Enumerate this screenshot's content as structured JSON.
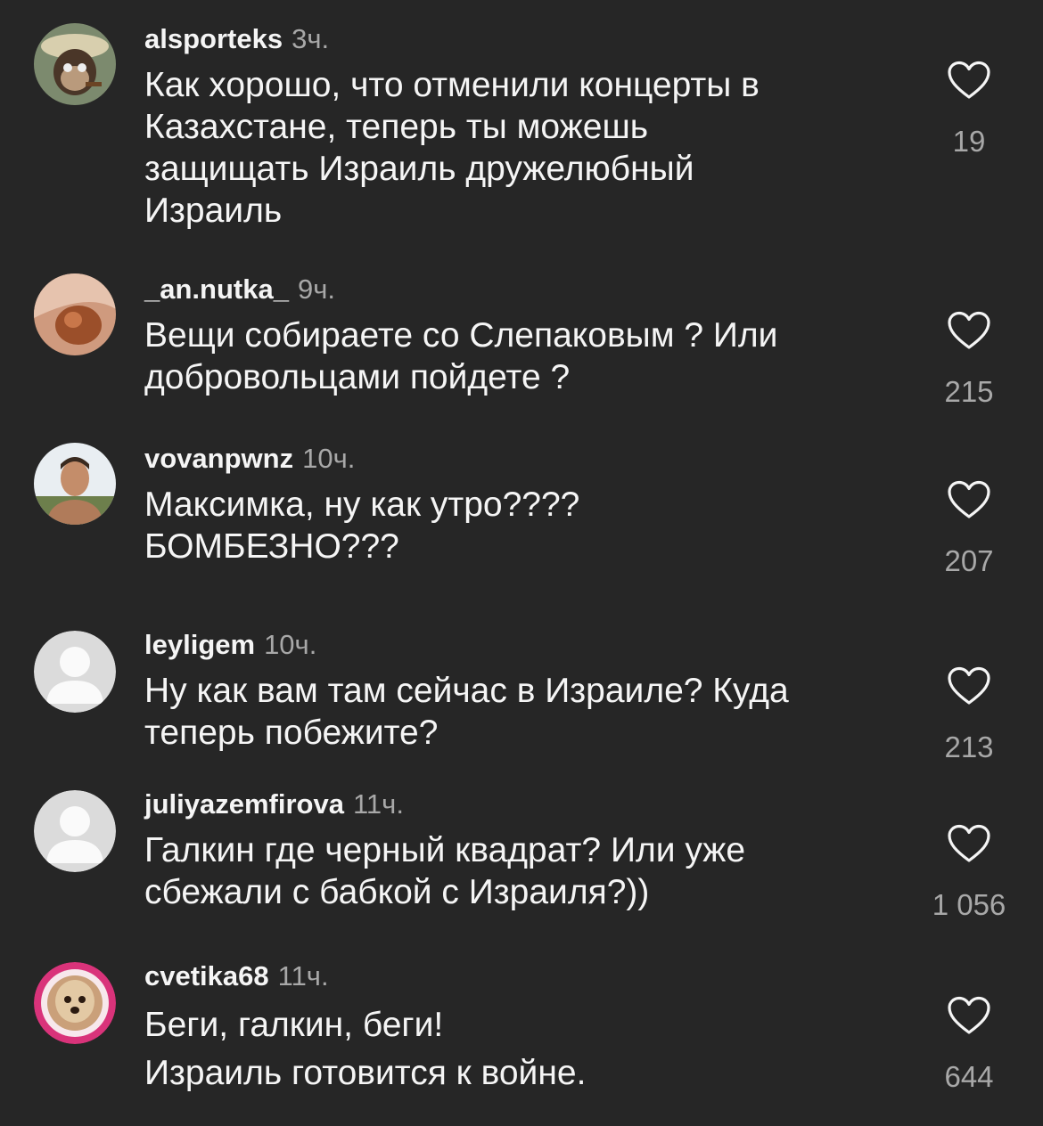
{
  "comments": [
    {
      "username": "alsporteks",
      "time": "3ч.",
      "text": "Как хорошо, что отменили концерты в\nКазахстане, теперь ты можешь\nзащищать Израиль дружелюбный\nИзраиль",
      "likes": "19",
      "avatar": "monkey-photo"
    },
    {
      "username": "_an.nutka_",
      "time": "9ч.",
      "text": "Вещи собираете со Слепаковым ? Или\nдобровольцами пойдете ?",
      "likes": "215",
      "avatar": "photo"
    },
    {
      "username": "vovanpwnz",
      "time": "10ч.",
      "text": "Максимка, ну как утро????\nБОМБЕЗНО???",
      "likes": "207",
      "avatar": "photo"
    },
    {
      "username": "leyligem",
      "time": "10ч.",
      "text": "Ну как вам там сейчас в Израиле? Куда\nтеперь побежите?",
      "likes": "213",
      "avatar": "default"
    },
    {
      "username": "juliyazemfirova",
      "time": "11ч.",
      "text": "Галкин где черный квадрат? Или уже\nсбежали с бабкой с Израиля?))",
      "likes": "1 056",
      "avatar": "default"
    },
    {
      "username": "cvetika68",
      "time": "11ч.",
      "text": "Беги, галкин, беги!\nИзраиль готовится к войне.",
      "likes": "644",
      "avatar": "dog-photo"
    }
  ],
  "colors": {
    "background": "#262626",
    "text": "#f5f5f5",
    "secondary": "#a8a8a8"
  }
}
